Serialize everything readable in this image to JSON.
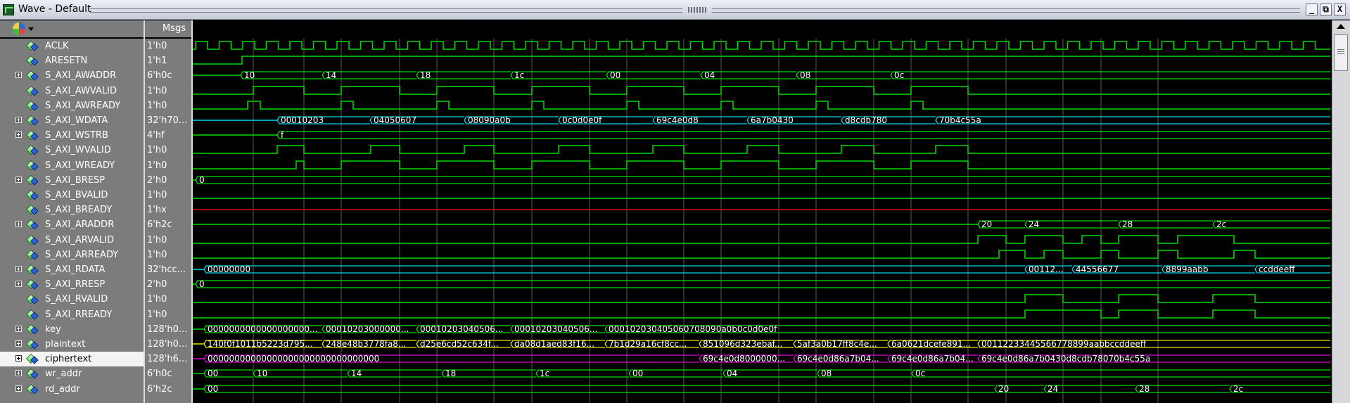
{
  "window": {
    "title": "Wave - Default",
    "buttons": [
      "_",
      "⧉",
      "X"
    ]
  },
  "toolbar": {
    "icon": "wave-toolbar-icon"
  },
  "header": {
    "msgs_label": "Msgs"
  },
  "signals": [
    {
      "name": "ACLK",
      "value": "1'h0",
      "kind": "bit",
      "expand": false
    },
    {
      "name": "ARESETN",
      "value": "1'h1",
      "kind": "bit",
      "expand": false
    },
    {
      "name": "S_AXI_AWADDR",
      "value": "6'h0c",
      "kind": "bus",
      "expand": true
    },
    {
      "name": "S_AXI_AWVALID",
      "value": "1'h0",
      "kind": "bit",
      "expand": false
    },
    {
      "name": "S_AXI_AWREADY",
      "value": "1'h0",
      "kind": "bit",
      "expand": false
    },
    {
      "name": "S_AXI_WDATA",
      "value": "32'h70...",
      "kind": "bus",
      "expand": true
    },
    {
      "name": "S_AXI_WSTRB",
      "value": "4'hf",
      "kind": "bus",
      "expand": true
    },
    {
      "name": "S_AXI_WVALID",
      "value": "1'h0",
      "kind": "bit",
      "expand": false
    },
    {
      "name": "S_AXI_WREADY",
      "value": "1'h0",
      "kind": "bit",
      "expand": false
    },
    {
      "name": "S_AXI_BRESP",
      "value": "2'h0",
      "kind": "bus",
      "expand": true
    },
    {
      "name": "S_AXI_BVALID",
      "value": "1'h0",
      "kind": "bit",
      "expand": false
    },
    {
      "name": "S_AXI_BREADY",
      "value": "1'hx",
      "kind": "bit",
      "expand": false
    },
    {
      "name": "S_AXI_ARADDR",
      "value": "6'h2c",
      "kind": "bus",
      "expand": true
    },
    {
      "name": "S_AXI_ARVALID",
      "value": "1'h0",
      "kind": "bit",
      "expand": false
    },
    {
      "name": "S_AXI_ARREADY",
      "value": "1'h0",
      "kind": "bit",
      "expand": false
    },
    {
      "name": "S_AXI_RDATA",
      "value": "32'hcc...",
      "kind": "bus",
      "expand": true
    },
    {
      "name": "S_AXI_RRESP",
      "value": "2'h0",
      "kind": "bus",
      "expand": true
    },
    {
      "name": "S_AXI_RVALID",
      "value": "1'h0",
      "kind": "bit",
      "expand": false
    },
    {
      "name": "S_AXI_RREADY",
      "value": "1'h0",
      "kind": "bit",
      "expand": false
    },
    {
      "name": "key",
      "value": "128'h0...",
      "kind": "bus",
      "expand": true
    },
    {
      "name": "plaintext",
      "value": "128'h0...",
      "kind": "bus",
      "expand": true
    },
    {
      "name": "ciphertext",
      "value": "128'h6...",
      "kind": "bus",
      "expand": true,
      "selected": true
    },
    {
      "name": "wr_addr",
      "value": "6'h0c",
      "kind": "bus",
      "expand": true
    },
    {
      "name": "rd_addr",
      "value": "6'h2c",
      "kind": "bus",
      "expand": true
    }
  ],
  "bus_values": {
    "S_AXI_AWADDR": [
      "10",
      "14",
      "18",
      "1c",
      "00",
      "04",
      "08",
      "0c"
    ],
    "S_AXI_WDATA": [
      "00010203",
      "04050607",
      "08090a0b",
      "0c0d0e0f",
      "69c4e0d8",
      "6a7b0430",
      "d8cdb780",
      "70b4c55a"
    ],
    "S_AXI_WSTRB": [
      "f"
    ],
    "S_AXI_BRESP": [
      "0"
    ],
    "S_AXI_ARADDR": [
      "20",
      "24",
      "28",
      "2c"
    ],
    "S_AXI_RDATA": [
      "00000000",
      "00112...",
      "44556677",
      "8899aabb",
      "ccddeeff"
    ],
    "S_AXI_RRESP": [
      "0"
    ],
    "key": [
      "0000000000000000000...",
      "00010203000000...",
      "00010203040506...",
      "00010203040506...",
      "000102030405060708090a0b0c0d0e0f"
    ],
    "plaintext": [
      "140f0f1011b5223d795...",
      "248e48b3778fa8...",
      "d25e6cd52c634f...",
      "da08d1aed83f16...",
      "7b1d29a16cf8cc...",
      "851096d323ebaf...",
      "5af3a0b17ff8c4e...",
      "6a0621dcefe891...",
      "00112233445566778899aabbccddeeff"
    ],
    "ciphertext": [
      "00000000000000000000000000000000",
      "69c4e0d8000000...",
      "69c4e0d86a7b04...",
      "69c4e0d86a7b04...",
      "69c4e0d86a7b0430d8cdb78070b4c55a"
    ],
    "wr_addr": [
      "00",
      "10",
      "14",
      "18",
      "1c",
      "00",
      "04",
      "08",
      "0c"
    ],
    "rd_addr": [
      "00",
      "20",
      "24",
      "28",
      "2c"
    ]
  },
  "colors": {
    "clock": "#00dd00",
    "red": "#dd0000",
    "cyan": "#00d8f0",
    "yellow": "#e8e800",
    "magenta": "#d800d8",
    "white": "#ffffff",
    "panel": "#7c7c7c"
  }
}
